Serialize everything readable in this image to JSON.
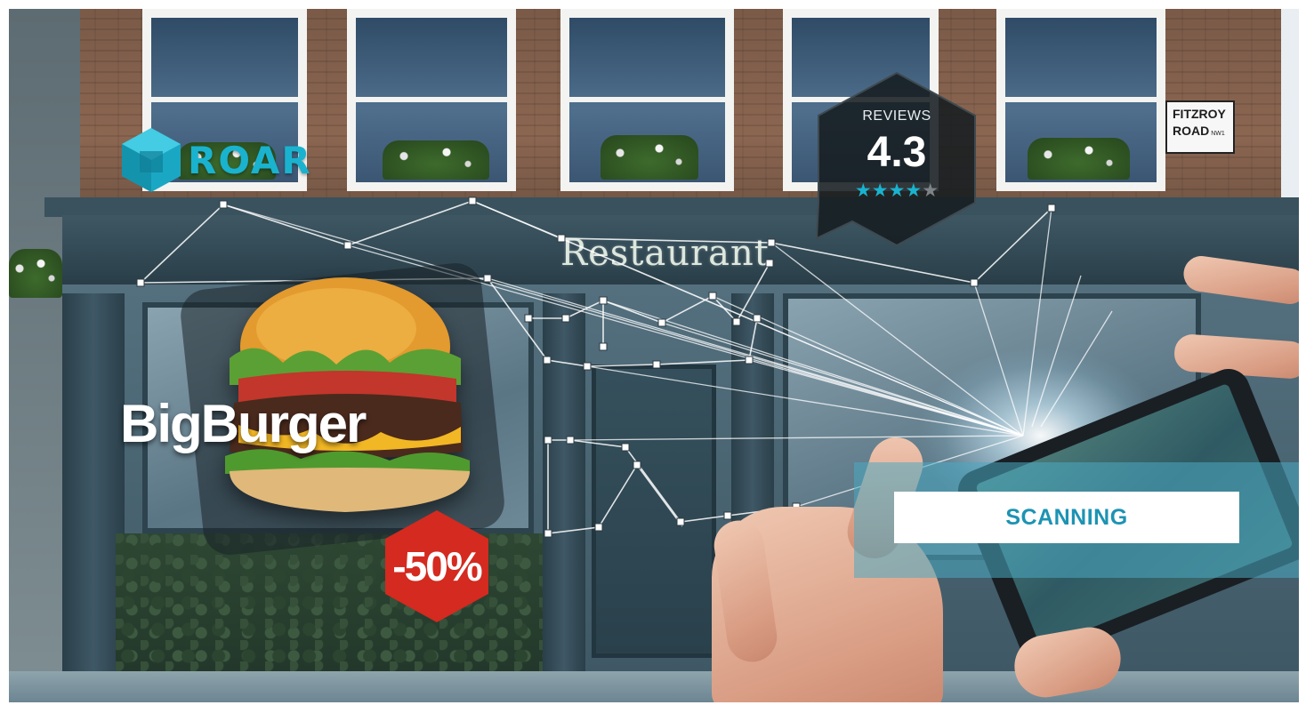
{
  "brand": {
    "logo_text": "ROAR",
    "logo_icon": "cube-icon",
    "accent_color": "#19b3cf"
  },
  "storefront": {
    "sign_text": "Restaurant",
    "street_sign": {
      "line1": "FITZROY",
      "line2": "ROAD",
      "line2_suffix": "NW1"
    }
  },
  "reviews": {
    "label": "REVIEWS",
    "score": "4.3",
    "stars_filled": 4,
    "stars_total": 5,
    "star_color": "#19b3cf"
  },
  "promo": {
    "product_name": "BigBurger",
    "discount": "-50%",
    "discount_color": "#d42a1f"
  },
  "scanner": {
    "status_label": "SCANNING",
    "status_color": "#1d93b3"
  }
}
